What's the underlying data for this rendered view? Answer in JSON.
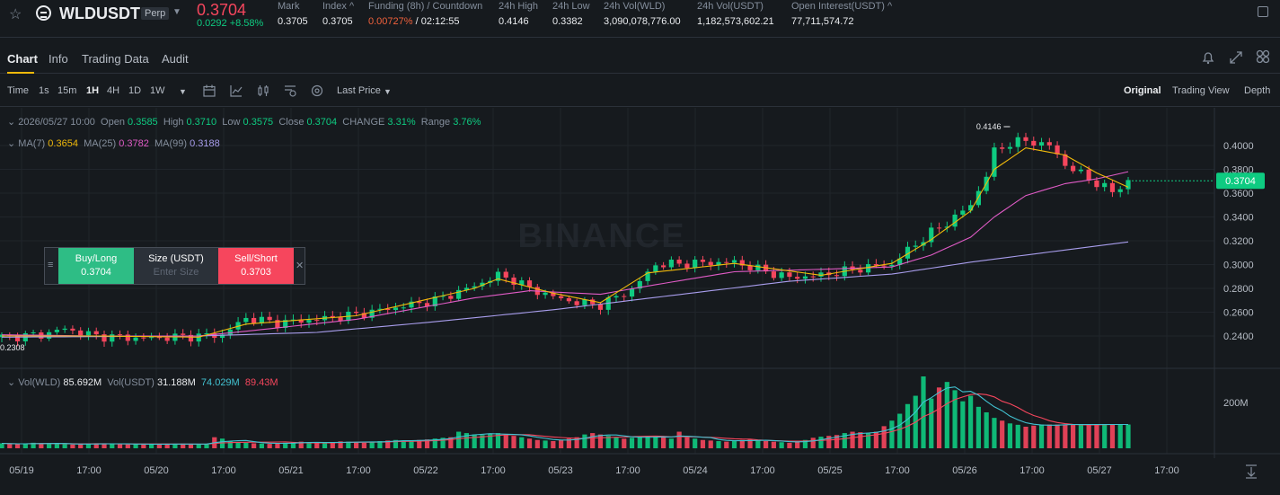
{
  "header": {
    "symbol": "WLDUSDT",
    "badge": "Perp",
    "last_price": "0.3704",
    "change": "0.0292 +8.58%",
    "stats": [
      {
        "label": "Mark",
        "value": "0.3705"
      },
      {
        "label": "Index ^",
        "value": "0.3705"
      },
      {
        "label": "Funding (8h) / Countdown",
        "value_a": "0.00727%",
        "value_b": " / 02:12:55"
      },
      {
        "label": "24h High",
        "value": "0.4146"
      },
      {
        "label": "24h Low",
        "value": "0.3382"
      },
      {
        "label": "24h Vol(WLD)",
        "value": "3,090,078,776.00"
      },
      {
        "label": "24h Vol(USDT)",
        "value": "1,182,573,602.21"
      },
      {
        "label": "Open Interest(USDT) ^",
        "value": "77,711,574.72"
      }
    ]
  },
  "tabs": [
    "Chart",
    "Info",
    "Trading Data",
    "Audit"
  ],
  "toolbar": {
    "intervals": [
      "Time",
      "1s",
      "15m",
      "1H",
      "4H",
      "1D",
      "1W"
    ],
    "active_interval": "1H",
    "price_type": "Last Price",
    "views": [
      "Original",
      "Trading View",
      "Depth"
    ]
  },
  "ohlc": {
    "date": "2026/05/27 10:00",
    "open_label": "Open",
    "open": "0.3585",
    "high_label": "High",
    "high": "0.3710",
    "low_label": "Low",
    "low": "0.3575",
    "close_label": "Close",
    "close": "0.3704",
    "change_label": "CHANGE",
    "change": "3.31%",
    "range_label": "Range",
    "range": "3.76%"
  },
  "ma": {
    "ma7_label": "MA(7)",
    "ma7": "0.3654",
    "ma25_label": "MA(25)",
    "ma25": "0.3782",
    "ma99_label": "MA(99)",
    "ma99": "0.3188"
  },
  "vol_info": {
    "wld_label": "Vol(WLD)",
    "wld": "85.692M",
    "usdt_label": "Vol(USDT)",
    "usdt": "31.188M",
    "ma1": "74.029M",
    "ma2": "89.43M"
  },
  "order_panel": {
    "buy_label": "Buy/Long",
    "buy_price": "0.3704",
    "size_label": "Size (USDT)",
    "size_placeholder": "Enter Size",
    "sell_label": "Sell/Short",
    "sell_price": "0.3703"
  },
  "watermark": "BINANCE",
  "colors": {
    "up": "#0ecb81",
    "down": "#f6465d",
    "ma7": "#f0b90b",
    "ma25": "#e05bc6",
    "ma99": "#a89dec"
  },
  "chart_data": {
    "type": "candlestick",
    "y_ticks": [
      "0.4000",
      "0.3800",
      "0.3600",
      "0.3400",
      "0.3200",
      "0.3000",
      "0.2800",
      "0.2600",
      "0.2400"
    ],
    "ylim": [
      0.224,
      0.423
    ],
    "x_ticks": [
      "05/19",
      "17:00",
      "05/20",
      "17:00",
      "05/21",
      "17:00",
      "05/22",
      "17:00",
      "05/23",
      "17:00",
      "05/24",
      "17:00",
      "05/25",
      "17:00",
      "05/26",
      "17:00",
      "05/27",
      "17:00"
    ],
    "current_price": "0.3704",
    "high_marker": "0.4146",
    "low_marker": "0.2308",
    "vol_tick": "200M",
    "close_path": [
      [
        0,
        0.239
      ],
      [
        5,
        0.241
      ],
      [
        8,
        0.246
      ],
      [
        12,
        0.24
      ],
      [
        18,
        0.238
      ],
      [
        25,
        0.24
      ],
      [
        28,
        0.241
      ],
      [
        31,
        0.255
      ],
      [
        35,
        0.251
      ],
      [
        40,
        0.254
      ],
      [
        45,
        0.258
      ],
      [
        50,
        0.264
      ],
      [
        55,
        0.27
      ],
      [
        60,
        0.282
      ],
      [
        63,
        0.291
      ],
      [
        65,
        0.287
      ],
      [
        67,
        0.28
      ],
      [
        70,
        0.273
      ],
      [
        73,
        0.268
      ],
      [
        76,
        0.266
      ],
      [
        80,
        0.279
      ],
      [
        83,
        0.3
      ],
      [
        87,
        0.301
      ],
      [
        93,
        0.302
      ],
      [
        96,
        0.296
      ],
      [
        100,
        0.289
      ],
      [
        104,
        0.291
      ],
      [
        110,
        0.298
      ],
      [
        113,
        0.3
      ],
      [
        115,
        0.312
      ],
      [
        118,
        0.327
      ],
      [
        120,
        0.335
      ],
      [
        123,
        0.35
      ],
      [
        125,
        0.375
      ],
      [
        126,
        0.395
      ],
      [
        128,
        0.402
      ],
      [
        130,
        0.404
      ],
      [
        133,
        0.4
      ],
      [
        135,
        0.384
      ],
      [
        138,
        0.372
      ],
      [
        141,
        0.361
      ],
      [
        143,
        0.37
      ]
    ],
    "ma7": [
      [
        0,
        0.24
      ],
      [
        12,
        0.24
      ],
      [
        25,
        0.239
      ],
      [
        31,
        0.25
      ],
      [
        45,
        0.257
      ],
      [
        60,
        0.28
      ],
      [
        63,
        0.288
      ],
      [
        70,
        0.276
      ],
      [
        76,
        0.268
      ],
      [
        82,
        0.293
      ],
      [
        93,
        0.301
      ],
      [
        104,
        0.291
      ],
      [
        113,
        0.301
      ],
      [
        118,
        0.321
      ],
      [
        123,
        0.345
      ],
      [
        126,
        0.38
      ],
      [
        130,
        0.398
      ],
      [
        135,
        0.392
      ],
      [
        139,
        0.377
      ],
      [
        143,
        0.365
      ]
    ],
    "ma25": [
      [
        0,
        0.241
      ],
      [
        12,
        0.24
      ],
      [
        25,
        0.24
      ],
      [
        31,
        0.244
      ],
      [
        45,
        0.254
      ],
      [
        60,
        0.272
      ],
      [
        67,
        0.278
      ],
      [
        76,
        0.275
      ],
      [
        82,
        0.282
      ],
      [
        93,
        0.294
      ],
      [
        104,
        0.296
      ],
      [
        113,
        0.298
      ],
      [
        118,
        0.308
      ],
      [
        123,
        0.323
      ],
      [
        126,
        0.34
      ],
      [
        130,
        0.358
      ],
      [
        135,
        0.368
      ],
      [
        139,
        0.372
      ],
      [
        143,
        0.378
      ]
    ],
    "ma99": [
      [
        0,
        0.239
      ],
      [
        25,
        0.24
      ],
      [
        40,
        0.243
      ],
      [
        55,
        0.252
      ],
      [
        70,
        0.262
      ],
      [
        85,
        0.274
      ],
      [
        100,
        0.286
      ],
      [
        113,
        0.292
      ],
      [
        123,
        0.302
      ],
      [
        130,
        0.308
      ],
      [
        143,
        0.319
      ]
    ],
    "volume_m": [
      18,
      16,
      15,
      16,
      20,
      18,
      17,
      16,
      15,
      14,
      15,
      16,
      18,
      17,
      16,
      15,
      14,
      15,
      16,
      15,
      14,
      15,
      16,
      17,
      15,
      14,
      15,
      40,
      35,
      25,
      22,
      20,
      18,
      17,
      16,
      18,
      20,
      22,
      24,
      22,
      20,
      18,
      22,
      25,
      24,
      22,
      20,
      24,
      26,
      28,
      30,
      28,
      26,
      30,
      32,
      35,
      38,
      40,
      60,
      55,
      50,
      48,
      52,
      55,
      50,
      45,
      40,
      35,
      30,
      28,
      26,
      30,
      35,
      40,
      50,
      55,
      50,
      45,
      40,
      35,
      38,
      42,
      45,
      42,
      40,
      35,
      60,
      40,
      35,
      30,
      28,
      26,
      24,
      28,
      30,
      32,
      28,
      26,
      24,
      22,
      20,
      24,
      30,
      38,
      42,
      45,
      48,
      55,
      60,
      58,
      55,
      60,
      80,
      100,
      125,
      160,
      190,
      260,
      180,
      220,
      240,
      210,
      170,
      190,
      150,
      130,
      110,
      100,
      90,
      85,
      78,
      82,
      86
    ]
  }
}
